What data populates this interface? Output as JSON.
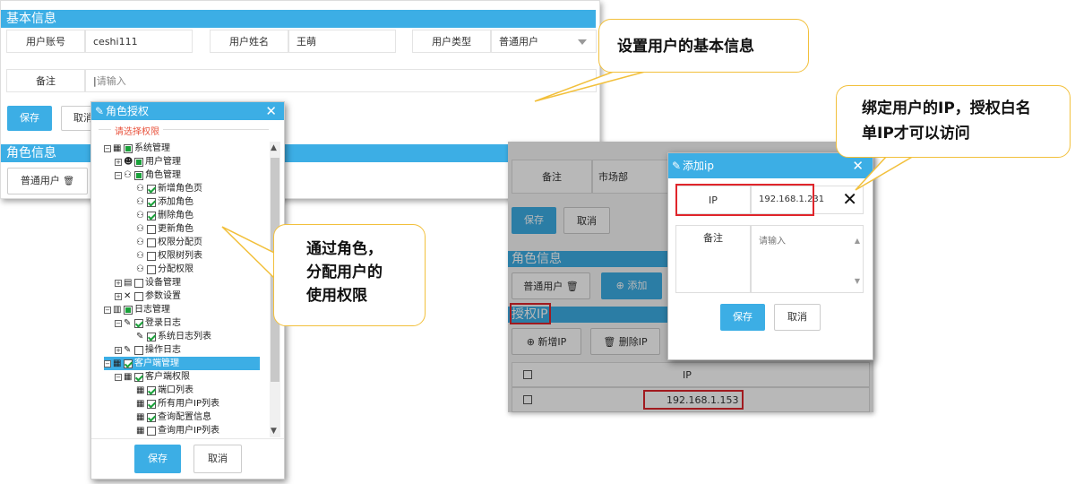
{
  "basic_panel": {
    "section_basic": "基本信息",
    "account_label": "用户账号",
    "account_value": "ceshi111",
    "name_label": "用户姓名",
    "name_value": "王萌",
    "type_label": "用户类型",
    "type_value": "普通用户",
    "remark_label": "备注",
    "remark_placeholder": "请输入",
    "save": "保存",
    "cancel": "取消",
    "section_role": "角色信息",
    "role_tag": "普通用户"
  },
  "role_dialog": {
    "title": "角色授权",
    "legend": "请选择权限",
    "tree": [
      {
        "label": "系统管理",
        "check": "partial",
        "expander": "−",
        "icon": "grid"
      },
      {
        "label": "用户管理",
        "check": "partial",
        "expander": "+",
        "icon": "user"
      },
      {
        "label": "角色管理",
        "check": "partial",
        "expander": "−",
        "icon": "users"
      },
      {
        "label": "新增角色页",
        "check": "checked",
        "icon": "users"
      },
      {
        "label": "添加角色",
        "check": "checked",
        "icon": "users"
      },
      {
        "label": "删除角色",
        "check": "checked",
        "icon": "users"
      },
      {
        "label": "更新角色",
        "check": "none",
        "icon": "users"
      },
      {
        "label": "权限分配页",
        "check": "none",
        "icon": "users"
      },
      {
        "label": "权限树列表",
        "check": "none",
        "icon": "users"
      },
      {
        "label": "分配权限",
        "check": "none",
        "icon": "users"
      },
      {
        "label": "设备管理",
        "check": "none",
        "expander": "+",
        "icon": "device"
      },
      {
        "label": "参数设置",
        "check": "none",
        "expander": "+",
        "icon": "tools"
      },
      {
        "label": "日志管理",
        "check": "partial",
        "expander": "−",
        "icon": "log"
      },
      {
        "label": "登录日志",
        "check": "checked",
        "expander": "−",
        "icon": "edit"
      },
      {
        "label": "系统日志列表",
        "check": "checked",
        "icon": "edit"
      },
      {
        "label": "操作日志",
        "check": "none",
        "expander": "+",
        "icon": "edit"
      },
      {
        "label": "客户端管理",
        "check": "checked",
        "expander": "−",
        "icon": "grid"
      },
      {
        "label": "客户端权限",
        "check": "checked",
        "expander": "−",
        "icon": "grid"
      },
      {
        "label": "端口列表",
        "check": "checked",
        "icon": "grid"
      },
      {
        "label": "所有用户IP列表",
        "check": "checked",
        "icon": "grid"
      },
      {
        "label": "查询配置信息",
        "check": "checked",
        "icon": "grid"
      },
      {
        "label": "查询用户IP列表",
        "check": "none",
        "icon": "grid"
      }
    ],
    "selected_index": 16,
    "save": "保存",
    "cancel": "取消"
  },
  "callouts": {
    "basic": "设置用户的基本信息",
    "role_line1": "通过角色，",
    "role_line2": "分配用户的",
    "role_line3": "使用权限",
    "ip_line1": "绑定用户的IP，授权白名",
    "ip_line2": "单IP才可以访问"
  },
  "ip_screen": {
    "remark_label": "备注",
    "remark_value": "市场部",
    "save": "保存",
    "cancel": "取消",
    "section_role": "角色信息",
    "role_tag": "普通用户",
    "add": "添加",
    "section_ip": "授权IP",
    "add_ip": "新增IP",
    "delete_ip": "删除IP",
    "col_ip": "IP",
    "rows": [
      "192.168.1.153"
    ]
  },
  "addip_dialog": {
    "title": "添加ip",
    "ip_label": "IP",
    "ip_value": "192.168.1.231",
    "remark_label": "备注",
    "remark_placeholder": "请输入",
    "save": "保存",
    "cancel": "取消"
  }
}
